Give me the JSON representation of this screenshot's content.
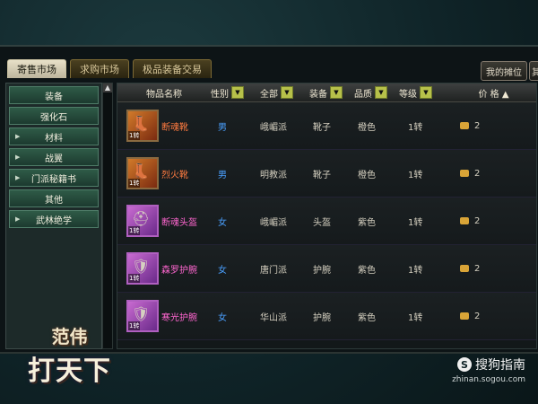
{
  "tabs": [
    {
      "label": "寄售市场",
      "active": true
    },
    {
      "label": "求购市场",
      "active": false
    },
    {
      "label": "极品装备交易",
      "active": false
    }
  ],
  "top_buttons": {
    "my_stall": "我的摊位",
    "extra": "其"
  },
  "sidebar": {
    "items": [
      {
        "label": "装备",
        "has_arrow": false
      },
      {
        "label": "强化石",
        "has_arrow": false
      },
      {
        "label": "材料",
        "has_arrow": true
      },
      {
        "label": "战翼",
        "has_arrow": true
      },
      {
        "label": "门派秘籍书",
        "has_arrow": true
      },
      {
        "label": "其他",
        "has_arrow": false
      },
      {
        "label": "武林绝学",
        "has_arrow": true
      }
    ]
  },
  "table": {
    "headers": {
      "name": "物品名称",
      "gender": "性别",
      "sect": "全部",
      "slot": "装备",
      "quality": "品质",
      "level": "等级",
      "price": "价 格 ▲"
    },
    "rows": [
      {
        "name": "断魂靴",
        "gender": "男",
        "sect": "峨嵋派",
        "slot": "靴子",
        "quality": "橙色",
        "level": "1转",
        "price": "2",
        "color": "orange",
        "badge": "1转"
      },
      {
        "name": "烈火靴",
        "gender": "男",
        "sect": "明教派",
        "slot": "靴子",
        "quality": "橙色",
        "level": "1转",
        "price": "2",
        "color": "orange",
        "badge": "1转"
      },
      {
        "name": "断魂头盔",
        "gender": "女",
        "sect": "峨嵋派",
        "slot": "头盔",
        "quality": "紫色",
        "level": "1转",
        "price": "2",
        "color": "purple",
        "badge": "1转"
      },
      {
        "name": "森罗护腕",
        "gender": "女",
        "sect": "唐门派",
        "slot": "护腕",
        "quality": "紫色",
        "level": "1转",
        "price": "2",
        "color": "purple",
        "badge": "1转"
      },
      {
        "name": "寒光护腕",
        "gender": "女",
        "sect": "华山派",
        "slot": "护腕",
        "quality": "紫色",
        "level": "1转",
        "price": "2",
        "color": "purple",
        "badge": "1转"
      }
    ]
  },
  "logo": {
    "line1": "范伟",
    "line2": "打天下"
  },
  "watermark": {
    "icon": "S",
    "title": "搜狗指南",
    "url": "zhinan.sogou.com"
  }
}
